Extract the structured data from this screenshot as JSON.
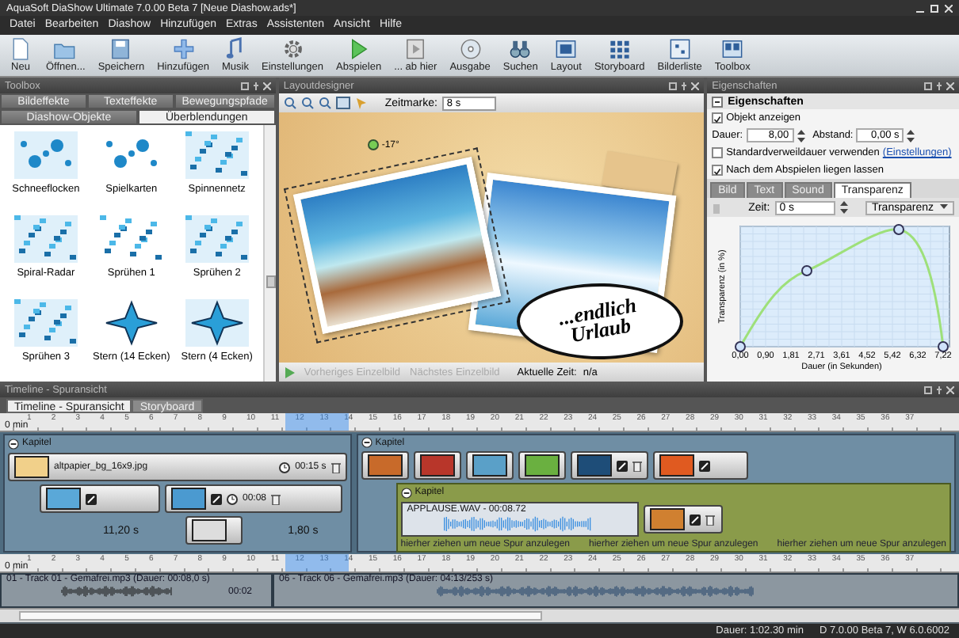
{
  "window": {
    "title": "AquaSoft DiaShow Ultimate 7.0.00 Beta 7 [Neue Diashow.ads*]"
  },
  "menu": [
    "Datei",
    "Bearbeiten",
    "Diashow",
    "Hinzufügen",
    "Extras",
    "Assistenten",
    "Ansicht",
    "Hilfe"
  ],
  "toolbar": [
    {
      "label": "Neu",
      "kind": "page"
    },
    {
      "label": "Öffnen...",
      "kind": "folder"
    },
    {
      "label": "Speichern",
      "kind": "disk"
    },
    {
      "label": "Hinzufügen",
      "kind": "plus"
    },
    {
      "label": "Musik",
      "kind": "note"
    },
    {
      "label": "Einstellungen",
      "kind": "gear"
    },
    {
      "label": "Abspielen",
      "kind": "play"
    },
    {
      "label": "... ab hier",
      "kind": "playpage"
    },
    {
      "label": "Ausgabe",
      "kind": "disc"
    },
    {
      "label": "Suchen",
      "kind": "binoculars"
    },
    {
      "label": "Layout",
      "kind": "layout"
    },
    {
      "label": "Storyboard",
      "kind": "grid"
    },
    {
      "label": "Bilderliste",
      "kind": "list"
    },
    {
      "label": "Toolbox",
      "kind": "toolbox"
    }
  ],
  "toolbox": {
    "title": "Toolbox",
    "tabs_row_1": [
      {
        "label": "Bildeffekte",
        "selected": false
      },
      {
        "label": "Texteffekte",
        "selected": false
      },
      {
        "label": "Bewegungspfade",
        "selected": false
      }
    ],
    "tabs_row_2": [
      {
        "label": "Diashow-Objekte",
        "selected": false
      },
      {
        "label": "Überblendungen",
        "selected": true
      }
    ],
    "items": [
      "Schneeflocken",
      "Spielkarten",
      "Spinnennetz",
      "Spiral-Radar",
      "Sprühen 1",
      "Sprühen 2",
      "Sprühen 3",
      "Stern (14 Ecken)",
      "Stern (4 Ecken)"
    ]
  },
  "designer": {
    "title": "Layoutdesigner",
    "time_label": "Zeitmarke:",
    "time_value": "8 s",
    "rotation": "-17°",
    "caption": "...endlich Urlaub",
    "prev_button": {
      "label": "Vorheriges Einzelbild",
      "disabled": true
    },
    "next_button": {
      "label": "Nächstes Einzelbild",
      "disabled": true
    },
    "current_time_label": "Aktuelle Zeit:",
    "current_time": "n/a"
  },
  "properties": {
    "title": "Eigenschaften",
    "section": "Eigenschaften",
    "expanded": true,
    "show_object": {
      "label": "Objekt anzeigen",
      "checked": true
    },
    "duration": {
      "label": "Dauer:",
      "value": "8,00"
    },
    "gap": {
      "label": "Abstand:",
      "value": "0,00 s"
    },
    "default_duration": {
      "label": "Standardverweildauer verwenden",
      "checked": false,
      "link": "(Einstellungen)"
    },
    "keep_after": {
      "label": "Nach dem Abspielen liegen lassen",
      "checked": true
    },
    "tabs": [
      {
        "label": "Bild",
        "selected": false
      },
      {
        "label": "Text",
        "selected": false
      },
      {
        "label": "Sound",
        "selected": false
      },
      {
        "label": "Transparenz",
        "selected": true
      }
    ],
    "time_label": "Zeit:",
    "time_value": "0 s",
    "curve_dropdown": "Transparenz",
    "graph": {
      "ylabel": "Transparenz (in %)",
      "xlabel": "Dauer (in Sekunden)",
      "x_tick_labels": [
        "0,00",
        "0,90",
        "1,81",
        "2,71",
        "3,61",
        "4,52",
        "5,42",
        "6,32",
        "7,22"
      ]
    }
  },
  "timeline": {
    "title": "Timeline - Spuransicht",
    "tabs": [
      {
        "label": "Timeline - Spuransicht",
        "selected": true
      },
      {
        "label": "Storyboard",
        "selected": false
      }
    ],
    "ruler_start": "0 min",
    "ruler_labels": [
      "1",
      "2",
      "3",
      "4",
      "5",
      "6",
      "7",
      "8",
      "9",
      "10",
      "11",
      "12",
      "13",
      "14",
      "15",
      "16",
      "17",
      "18",
      "19",
      "20",
      "21",
      "22",
      "23",
      "24",
      "25",
      "26",
      "27",
      "28",
      "29",
      "30",
      "31",
      "32",
      "33",
      "34",
      "35",
      "36",
      "37"
    ],
    "chapter_left": {
      "label": "Kapitel",
      "background": "altpapier_bg_16x9.jpg",
      "background_duration": "00:15 s",
      "clip_duration": "00:08",
      "length_left": "11,20 s",
      "length_right": "1,80 s"
    },
    "chapter_right": {
      "label": "Kapitel",
      "nested_label": "Kapitel",
      "audio": "APPLAUSE.WAV - 00:08.72",
      "drop_hints": [
        "hierher ziehen um neue Spur anzulegen",
        "hierher ziehen um neue Spur anzulegen",
        "hierher ziehen um neue Spur anzulegen"
      ]
    },
    "audio_ruler_start": "0 min",
    "audio_ruler_labels": [
      "1",
      "2",
      "3",
      "4",
      "5",
      "6",
      "7",
      "8",
      "9",
      "10",
      "11",
      "12",
      "13",
      "14",
      "15",
      "16",
      "17",
      "18",
      "19",
      "20",
      "21",
      "22",
      "23",
      "24",
      "25",
      "26",
      "27",
      "28",
      "29",
      "30",
      "31",
      "32",
      "33",
      "34",
      "35",
      "36",
      "37"
    ],
    "tracks": [
      {
        "label": "01 - Track 01 - Gemafrei.mp3 (Dauer: 00:08,0 s)",
        "end": "00:02"
      },
      {
        "label": "06 - Track 06 - Gemafrei.mp3 (Dauer: 04:13/253 s)"
      }
    ]
  },
  "status": {
    "duration": "Dauer: 1:02.30 min",
    "version": "D 7.0.00 Beta 7, W 6.0.6002"
  }
}
